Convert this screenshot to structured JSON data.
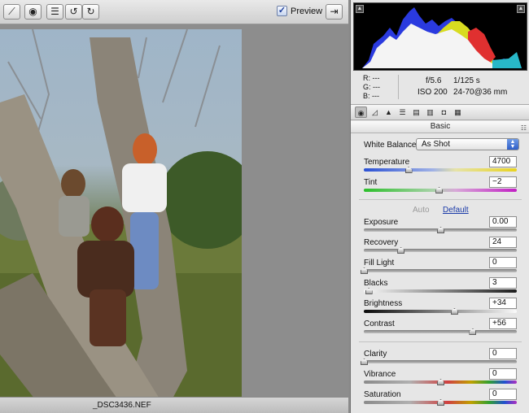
{
  "toolbar": {
    "preview_label": "Preview",
    "tools": [
      {
        "icon": "color-sampler-icon",
        "glyph": "⟋"
      },
      {
        "icon": "red-eye-icon",
        "glyph": "◉"
      },
      {
        "icon": "preferences-icon",
        "glyph": "☰"
      },
      {
        "icon": "rotate-left-icon",
        "glyph": "↺"
      },
      {
        "icon": "rotate-right-icon",
        "glyph": "↻"
      }
    ],
    "fullscreen_icon": "fullscreen-icon"
  },
  "canvas": {
    "filename": "_DSC3436.NEF"
  },
  "histogram": {
    "readout": {
      "r": "R:  ---",
      "g": "G:  ---",
      "b": "B:  ---"
    },
    "exif": {
      "aperture": "f/5.6",
      "shutter": "1/125 s",
      "iso": "ISO 200",
      "lens": "24-70@36 mm"
    }
  },
  "panel": {
    "section_title": "Basic",
    "white_balance": {
      "label": "White Balance:",
      "value": "As Shot"
    },
    "auto_label": "Auto",
    "default_label": "Default",
    "controls": [
      {
        "key": "temperature",
        "label": "Temperature",
        "value": "4700",
        "level": 0.29
      },
      {
        "key": "tint",
        "label": "Tint",
        "value": "−2",
        "level": 0.49
      },
      {
        "key": "exposure",
        "label": "Exposure",
        "value": "0.00",
        "level": 0.5
      },
      {
        "key": "recovery",
        "label": "Recovery",
        "value": "24",
        "level": 0.24
      },
      {
        "key": "fill-light",
        "label": "Fill Light",
        "value": "0",
        "level": 0.0
      },
      {
        "key": "blacks",
        "label": "Blacks",
        "value": "3",
        "level": 0.03
      },
      {
        "key": "brightness",
        "label": "Brightness",
        "value": "+34",
        "level": 0.59
      },
      {
        "key": "contrast",
        "label": "Contrast",
        "value": "+56",
        "level": 0.71
      },
      {
        "key": "clarity",
        "label": "Clarity",
        "value": "0",
        "level": 0.0
      },
      {
        "key": "vibrance",
        "label": "Vibrance",
        "value": "0",
        "level": 0.5
      },
      {
        "key": "saturation",
        "label": "Saturation",
        "value": "0",
        "level": 0.5
      }
    ]
  }
}
